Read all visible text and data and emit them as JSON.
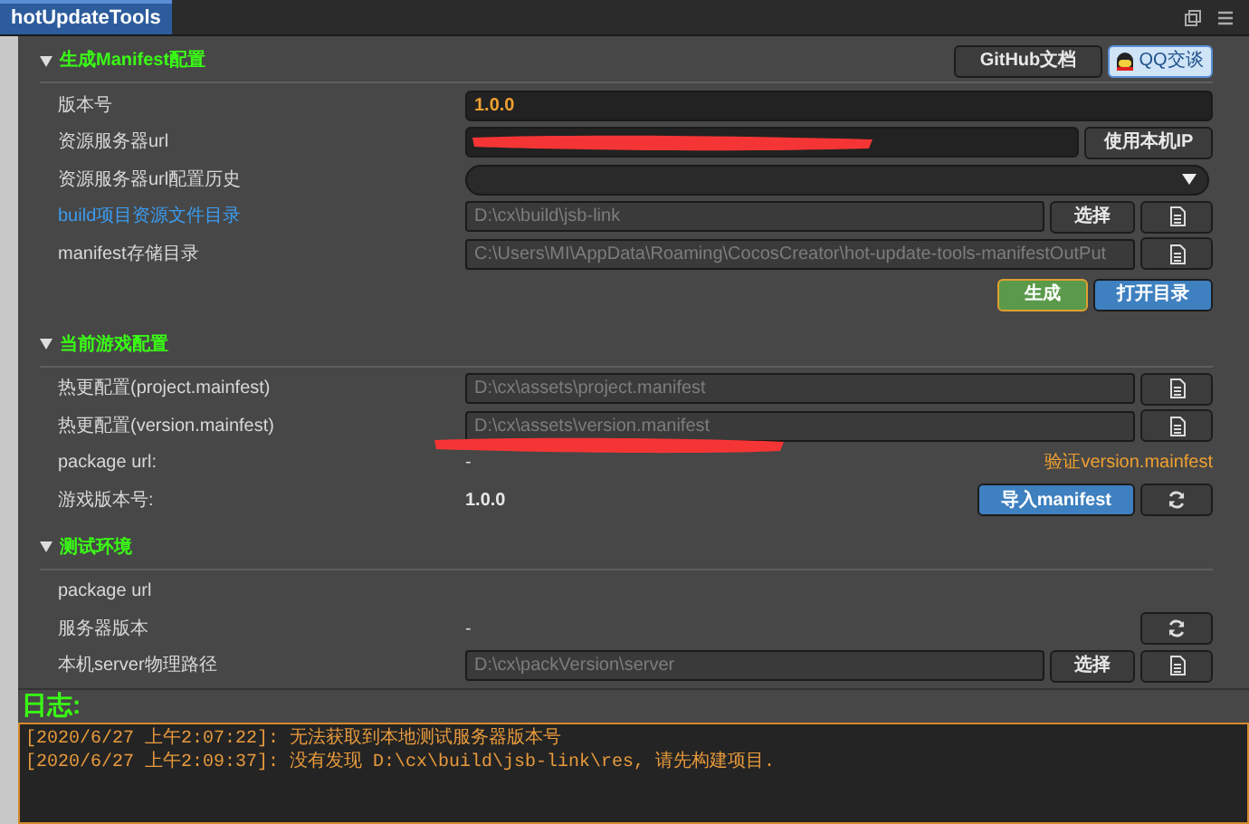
{
  "window": {
    "tab": "hotUpdateTools"
  },
  "sections": [
    {
      "title": "生成Manifest配置",
      "expanded": true,
      "header_buttons": [
        {
          "label": "GitHub文档",
          "kind": "plain"
        },
        {
          "label": "QQ交谈",
          "kind": "qq"
        }
      ],
      "rows": [
        {
          "kind": "value-input",
          "label": "版本号",
          "value": "1.0.0"
        },
        {
          "kind": "url-input",
          "label": "资源服务器url",
          "redacted": true,
          "buttons": [
            {
              "label": "使用本机IP",
              "kind": "text"
            }
          ]
        },
        {
          "kind": "dropdown",
          "label": "资源服务器url配置历史"
        },
        {
          "kind": "path",
          "label": "build项目资源文件目录",
          "link": true,
          "value": "D:\\cx\\build\\jsb-link",
          "buttons": [
            {
              "label": "选择",
              "kind": "text"
            },
            {
              "kind": "file"
            }
          ]
        },
        {
          "kind": "path",
          "label": "manifest存储目录",
          "link": false,
          "value": "C:\\Users\\MI\\AppData\\Roaming\\CocosCreator\\hot-update-tools-manifestOutPut",
          "buttons": [
            {
              "kind": "file"
            }
          ]
        },
        {
          "kind": "actions",
          "buttons": [
            {
              "label": "生成",
              "kind": "green"
            },
            {
              "label": "打开目录",
              "kind": "blue"
            }
          ]
        }
      ]
    },
    {
      "title": "当前游戏配置",
      "expanded": true,
      "rows": [
        {
          "kind": "path",
          "label": "热更配置(project.mainfest)",
          "link": false,
          "value": "D:\\cx\\assets\\project.manifest",
          "buttons": [
            {
              "kind": "file"
            }
          ]
        },
        {
          "kind": "path",
          "label": "热更配置(version.mainfest)",
          "link": false,
          "value": "D:\\cx\\assets\\version.manifest",
          "buttons": [
            {
              "kind": "file"
            }
          ]
        },
        {
          "kind": "text",
          "label": "package url:",
          "value": "-",
          "redacted": true,
          "link_text": "验证version.mainfest"
        },
        {
          "kind": "text",
          "label": "游戏版本号:",
          "value": "1.0.0",
          "bold": true,
          "buttons": [
            {
              "label": "导入manifest",
              "kind": "blue"
            },
            {
              "kind": "refresh"
            }
          ]
        }
      ]
    },
    {
      "title": "测试环境",
      "expanded": true,
      "rows": [
        {
          "kind": "text",
          "label": "package url"
        },
        {
          "kind": "text",
          "label": "服务器版本",
          "value": "-",
          "buttons": [
            {
              "kind": "refresh"
            }
          ]
        },
        {
          "kind": "path",
          "label": "本机server物理路径",
          "link": false,
          "value": "D:\\cx\\packVersion\\server",
          "buttons": [
            {
              "label": "选择",
              "kind": "text"
            },
            {
              "kind": "file"
            }
          ]
        }
      ]
    }
  ],
  "log": {
    "title": "日志:",
    "lines": [
      "[2020/6/27 上午2:07:22]: 无法获取到本地测试服务器版本号",
      "[2020/6/27 上午2:09:37]: 没有发现 D:\\cx\\build\\jsb-link\\res, 请先构建项目."
    ]
  }
}
